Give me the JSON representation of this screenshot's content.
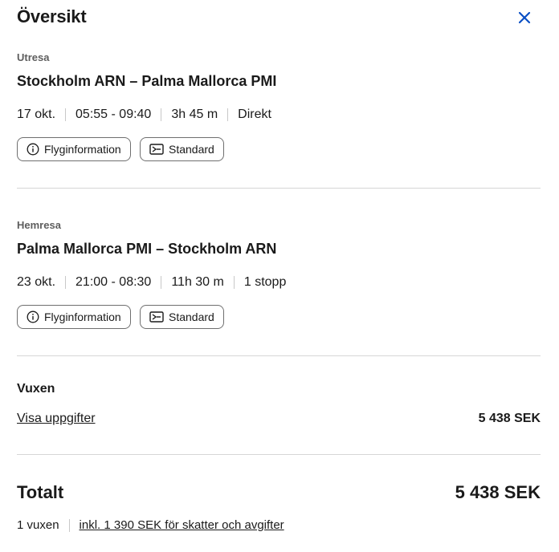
{
  "panel": {
    "title": "Översikt"
  },
  "colors": {
    "close_icon": "#0a4fc4",
    "divider": "#d6d6d6",
    "chip_border": "#6f6f6f"
  },
  "outbound": {
    "label": "Utresa",
    "route": "Stockholm ARN – Palma Mallorca PMI",
    "date": "17 okt.",
    "time": "05:55 - 09:40",
    "duration": "3h 45 m",
    "stops": "Direkt",
    "info_button": "Flyginformation",
    "fare_button": "Standard"
  },
  "inbound": {
    "label": "Hemresa",
    "route": "Palma Mallorca PMI – Stockholm ARN",
    "date": "23 okt.",
    "time": "21:00 - 08:30",
    "duration": "11h 30 m",
    "stops": "1 stopp",
    "info_button": "Flyginformation",
    "fare_button": "Standard"
  },
  "passenger": {
    "type": "Vuxen",
    "details_link": "Visa uppgifter",
    "price": "5 438 SEK"
  },
  "total": {
    "label": "Totalt",
    "price": "5 438 SEK",
    "travellers": "1 vuxen",
    "taxes_link": "inkl. 1 390 SEK för skatter och avgifter"
  },
  "icons": {
    "close": "close-icon",
    "info": "info-icon",
    "fare": "ticket-icon"
  }
}
